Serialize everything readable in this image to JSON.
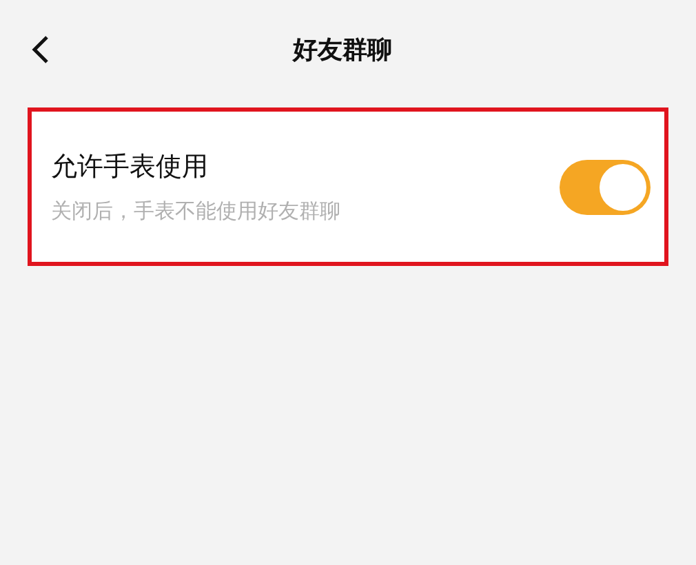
{
  "header": {
    "title": "好友群聊"
  },
  "setting": {
    "label": "允许手表使用",
    "description": "关闭后，手表不能使用好友群聊",
    "on": true,
    "highlighted": true
  }
}
